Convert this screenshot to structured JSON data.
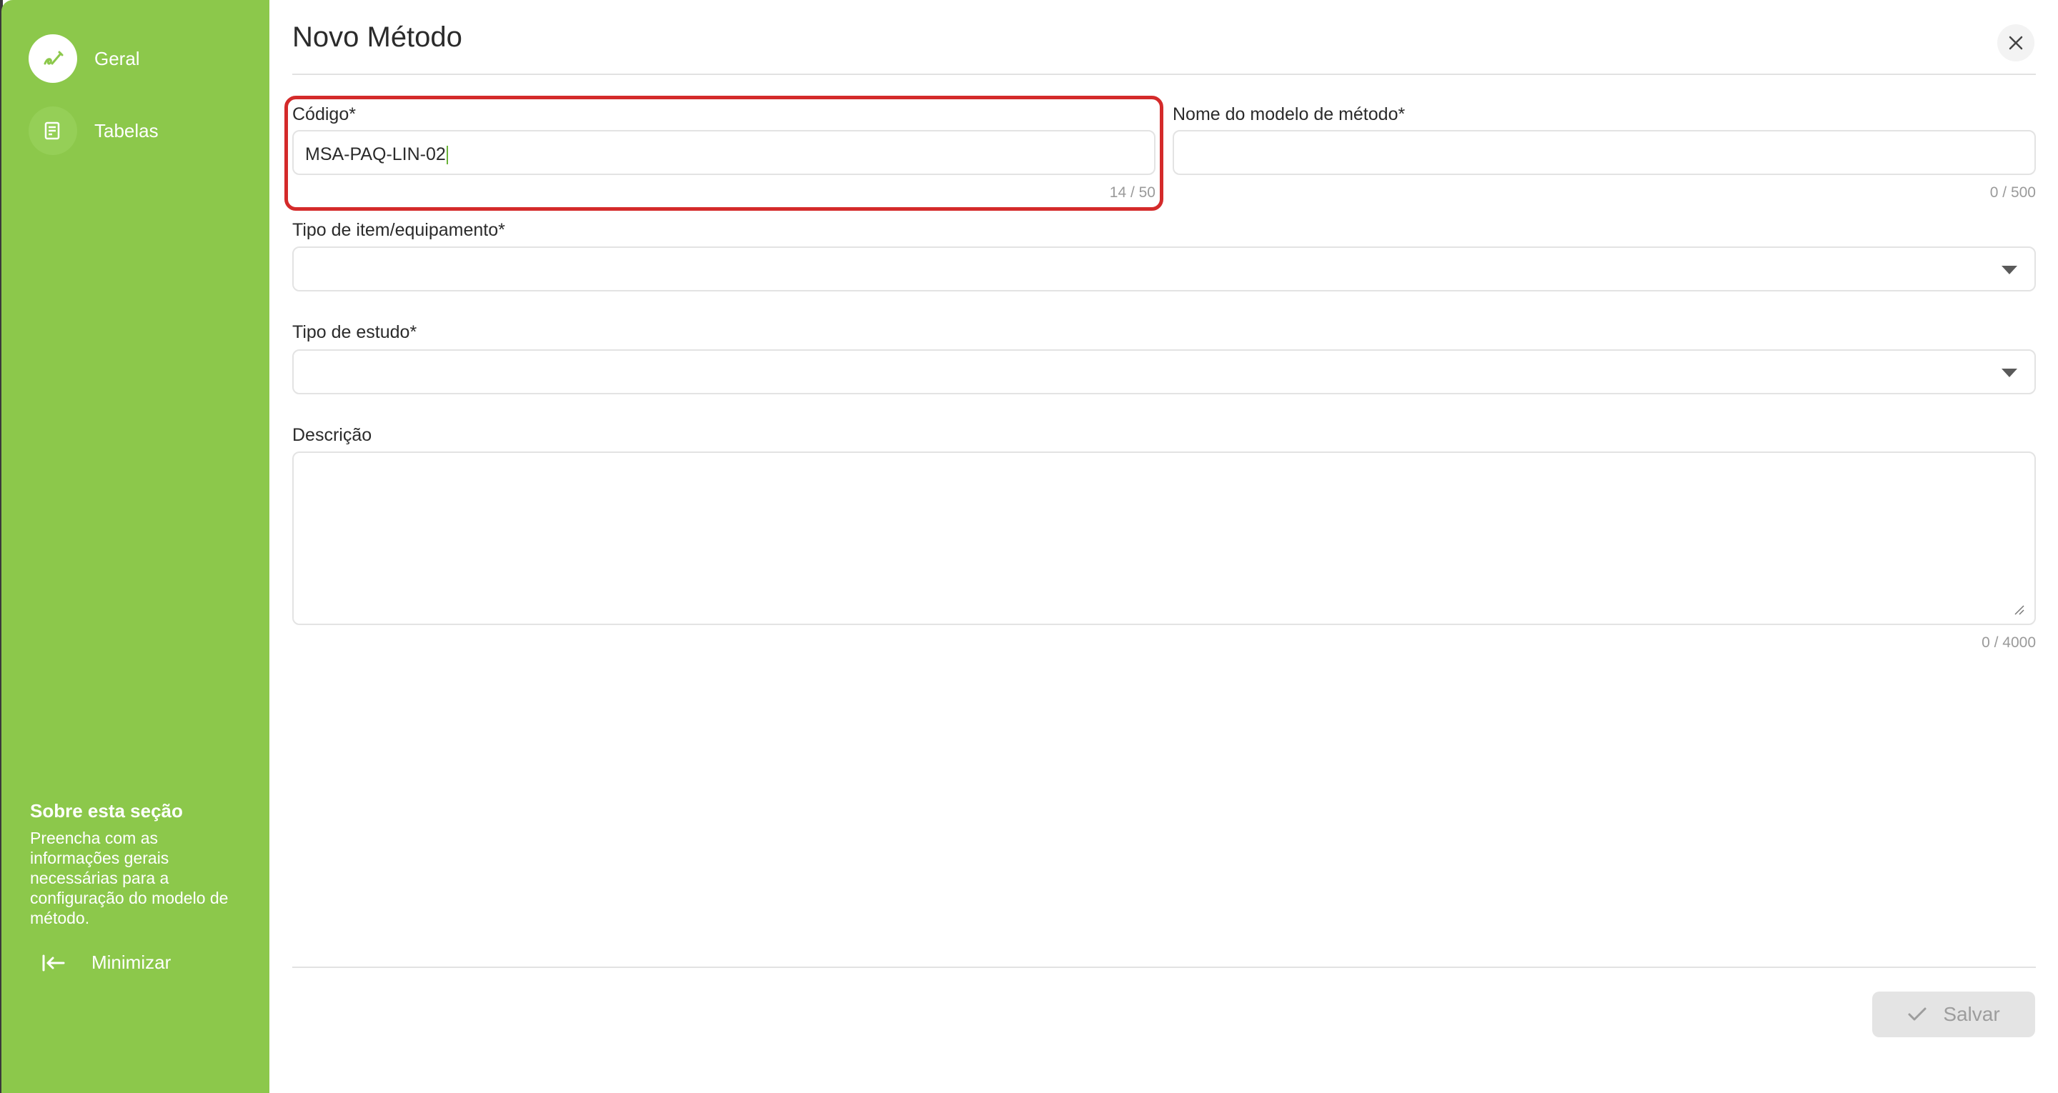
{
  "sidebar": {
    "items": [
      {
        "label": "Geral",
        "icon": "link-edit-icon",
        "active": true
      },
      {
        "label": "Tabelas",
        "icon": "table-list-icon",
        "active": false
      }
    ],
    "about": {
      "title": "Sobre esta seção",
      "text": "Preencha com as informações gerais necessárias para a configuração do modelo de método."
    },
    "minimize_label": "Minimizar"
  },
  "dialog": {
    "title": "Novo Método",
    "close_icon": "close-icon"
  },
  "form": {
    "codigo": {
      "label": "Código*",
      "value": "MSA-PAQ-LIN-02",
      "counter": "14 / 50"
    },
    "nome": {
      "label": "Nome do modelo de método*",
      "value": "",
      "counter": "0 / 500"
    },
    "tipo_item": {
      "label": "Tipo de item/equipamento*",
      "value": ""
    },
    "tipo_estudo": {
      "label": "Tipo de estudo*",
      "value": ""
    },
    "descricao": {
      "label": "Descrição",
      "value": "",
      "counter": "0 / 4000"
    }
  },
  "footer": {
    "save_label": "Salvar"
  },
  "colors": {
    "sidebar": "#8cc84b",
    "highlight": "#d42a2a",
    "disabled_button": "#e4e4e4"
  }
}
